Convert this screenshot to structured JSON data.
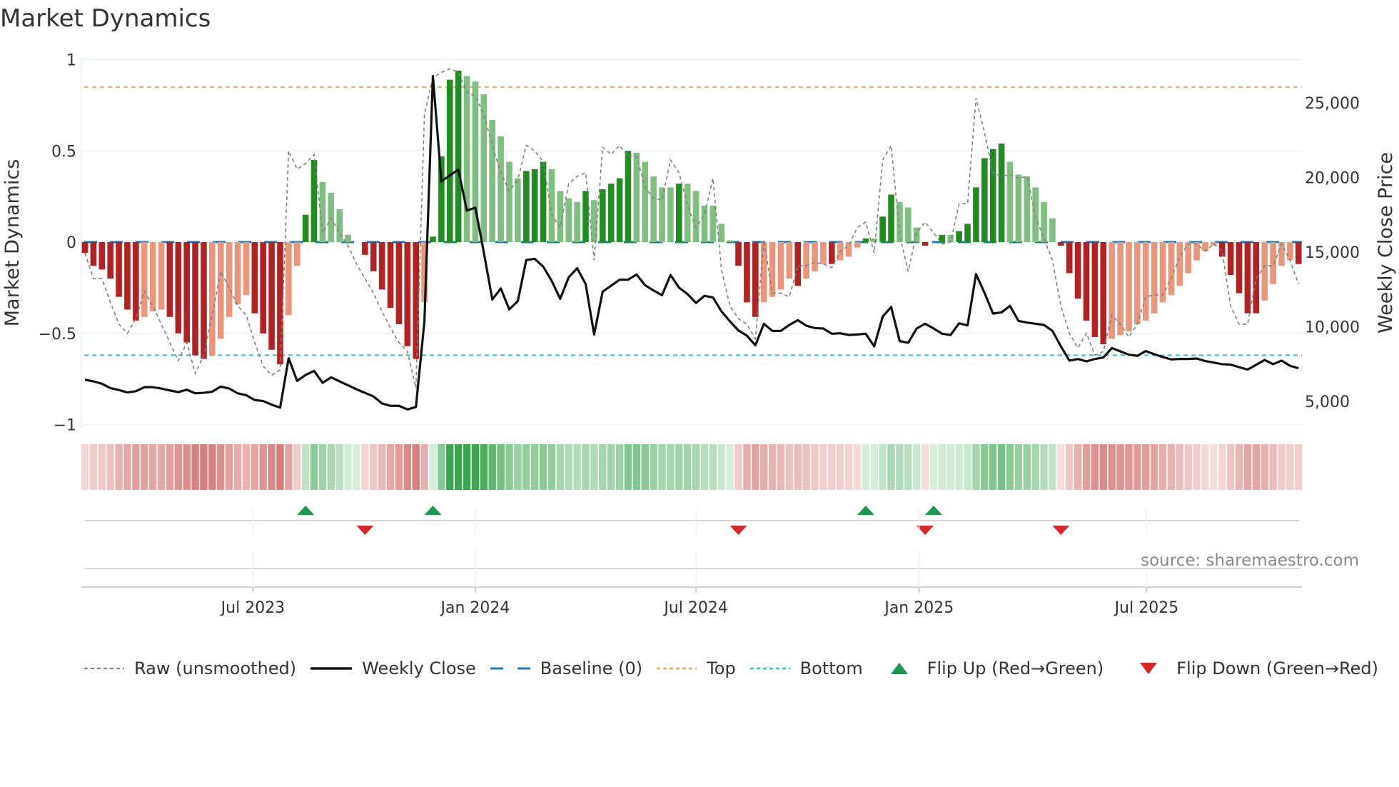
{
  "title": "Market Dynamics",
  "source": "source: sharemaestro.com",
  "legend": {
    "raw": "Raw (unsmoothed)",
    "close": "Weekly Close",
    "baseline": "Baseline (0)",
    "top": "Top",
    "bottom": "Bottom",
    "flip_up": "Flip Up (Red→Green)",
    "flip_down": "Flip Down (Green→Red)"
  },
  "colors": {
    "strong_pos": "#228b22",
    "weak_pos": "#7fbf7f",
    "strong_neg": "#b22222",
    "weak_neg": "#e9967a",
    "raw": "#808080",
    "close": "#111111",
    "baseline": "#1f77b4",
    "top": "#f0a860",
    "bottom": "#30c0d0",
    "flip_up": "#1a9850",
    "flip_down": "#d62728",
    "heat_pos": "#2ea043",
    "heat_neg": "#c8504c"
  },
  "chart_data": {
    "type": "bar",
    "frequency": "weekly",
    "y_left": {
      "label": "Market Dynamics",
      "range": [
        -1,
        1
      ],
      "ticks": [
        1,
        0.5,
        0,
        -0.5,
        -1
      ],
      "tick_labels": [
        "1",
        "0.5",
        "0",
        "−0.5",
        "−1"
      ]
    },
    "y_right": {
      "label": "Weekly Close Price",
      "ticks": [
        25000,
        20000,
        15000,
        10000,
        5000
      ],
      "tick_labels": [
        "25,000",
        "20,000",
        "15,000",
        "10,000",
        "5,000"
      ]
    },
    "x_ticks": [
      {
        "label": "Jul 2023",
        "week": 19.8
      },
      {
        "label": "Jan 2024",
        "week": 46.0
      },
      {
        "label": "Jul 2024",
        "week": 72.0
      },
      {
        "label": "Jan 2025",
        "week": 98.3
      },
      {
        "label": "Jul 2025",
        "week": 125.1
      }
    ],
    "top_level": 0.85,
    "bottom_level": -0.62,
    "baseline": 0,
    "smoothed": [
      -0.06,
      -0.13,
      -0.15,
      -0.2,
      -0.3,
      -0.37,
      -0.43,
      -0.41,
      -0.38,
      -0.37,
      -0.41,
      -0.5,
      -0.55,
      -0.62,
      -0.64,
      -0.62,
      -0.53,
      -0.41,
      -0.34,
      -0.29,
      -0.39,
      -0.5,
      -0.59,
      -0.67,
      -0.4,
      -0.13,
      0.15,
      0.45,
      0.33,
      0.27,
      0.18,
      0.04,
      0,
      -0.07,
      -0.16,
      -0.26,
      -0.36,
      -0.45,
      -0.57,
      -0.64,
      -0.33,
      0.03,
      0.47,
      0.89,
      0.94,
      0.91,
      0.88,
      0.81,
      0.67,
      0.58,
      0.44,
      0.35,
      0.39,
      0.4,
      0.44,
      0.4,
      0.28,
      0.24,
      0.22,
      0.28,
      0.23,
      0.29,
      0.32,
      0.35,
      0.5,
      0.49,
      0.44,
      0.36,
      0.3,
      0.3,
      0.32,
      0.32,
      0.28,
      0.2,
      0.2,
      0.1,
      0.01,
      -0.13,
      -0.33,
      -0.41,
      -0.33,
      -0.3,
      -0.26,
      -0.2,
      -0.24,
      -0.2,
      -0.16,
      -0.12,
      -0.12,
      -0.1,
      -0.08,
      -0.03,
      0.02,
      0.02,
      0.14,
      0.26,
      0.22,
      0.19,
      0.08,
      -0.02,
      0,
      0.04,
      0.04,
      0.06,
      0.1,
      0.3,
      0.46,
      0.51,
      0.54,
      0.44,
      0.37,
      0.36,
      0.3,
      0.22,
      0.13,
      -0.02,
      -0.17,
      -0.31,
      -0.43,
      -0.52,
      -0.56,
      -0.53,
      -0.51,
      -0.49,
      -0.45,
      -0.43,
      -0.39,
      -0.33,
      -0.29,
      -0.24,
      -0.17,
      -0.1,
      -0.05,
      -0.02,
      -0.08,
      -0.18,
      -0.28,
      -0.39,
      -0.39,
      -0.32,
      -0.23,
      -0.13,
      -0.1,
      -0.12
    ],
    "strong": [
      1,
      1,
      1,
      1,
      1,
      1,
      1,
      0,
      0,
      0,
      1,
      1,
      1,
      1,
      1,
      0,
      0,
      0,
      0,
      0,
      1,
      1,
      1,
      1,
      0,
      0,
      1,
      1,
      0,
      0,
      0,
      0,
      0,
      1,
      1,
      1,
      1,
      1,
      1,
      1,
      0,
      1,
      1,
      1,
      1,
      0,
      0,
      0,
      0,
      0,
      0,
      0,
      1,
      1,
      1,
      0,
      0,
      0,
      0,
      1,
      0,
      1,
      1,
      1,
      1,
      0,
      0,
      0,
      0,
      0,
      1,
      0,
      0,
      0,
      0,
      0,
      0,
      1,
      1,
      1,
      0,
      0,
      0,
      0,
      1,
      0,
      0,
      0,
      1,
      0,
      0,
      0,
      1,
      0,
      1,
      1,
      0,
      0,
      0,
      1,
      0,
      1,
      0,
      1,
      1,
      1,
      1,
      1,
      1,
      0,
      0,
      0,
      0,
      0,
      0,
      1,
      1,
      1,
      1,
      1,
      1,
      0,
      0,
      0,
      0,
      0,
      0,
      0,
      0,
      0,
      0,
      0,
      0,
      0,
      1,
      1,
      1,
      1,
      1,
      0,
      0,
      0,
      0,
      1
    ],
    "raw": [
      -0.06,
      -0.2,
      -0.2,
      -0.33,
      -0.45,
      -0.5,
      -0.42,
      -0.27,
      -0.35,
      -0.45,
      -0.55,
      -0.65,
      -0.55,
      -0.72,
      -0.62,
      -0.4,
      -0.16,
      -0.25,
      -0.35,
      -0.4,
      -0.55,
      -0.68,
      -0.73,
      -0.7,
      0.5,
      0.4,
      0.43,
      0.48,
      0.05,
      0.13,
      0.05,
      -0.02,
      -0.12,
      -0.2,
      -0.28,
      -0.38,
      -0.47,
      -0.55,
      -0.6,
      -0.8,
      0.7,
      0.9,
      0.93,
      0.95,
      0.93,
      0.82,
      0.8,
      0.7,
      0.53,
      0.38,
      0.28,
      0.34,
      0.53,
      0.5,
      0.44,
      0.15,
      0.08,
      0.32,
      0.36,
      0.38,
      -0.1,
      0.52,
      0.48,
      0.53,
      0.47,
      0.47,
      0.3,
      0.24,
      0.23,
      0.45,
      0.38,
      0.2,
      0.08,
      0.15,
      0.35,
      -0.15,
      -0.35,
      -0.42,
      -0.45,
      -0.53,
      0.01,
      -0.28,
      -0.28,
      -0.3,
      -0.13,
      -0.13,
      -0.11,
      -0.12,
      -0.14,
      -0.05,
      -0.02,
      0.08,
      0.11,
      -0.06,
      0.45,
      0.53,
      0.04,
      -0.16,
      0.05,
      0.11,
      0.05,
      -0.01,
      0,
      0.21,
      0.21,
      0.79,
      0.6,
      0.38,
      0.36,
      0.37,
      0.35,
      0.36,
      0.14,
      0.02,
      -0.1,
      -0.35,
      -0.5,
      -0.58,
      -0.5,
      -0.62,
      -0.6,
      -0.4,
      -0.45,
      -0.52,
      -0.45,
      -0.3,
      -0.29,
      -0.29,
      -0.2,
      -0.08,
      -0.01,
      -0.01,
      -0.05,
      -0.01,
      -0.05,
      -0.35,
      -0.45,
      -0.45,
      -0.2,
      -0.13,
      -0.13,
      -0.01,
      -0.1,
      -0.23
    ],
    "close": [
      6450,
      6340,
      6180,
      5890,
      5760,
      5600,
      5680,
      5950,
      5950,
      5860,
      5730,
      5620,
      5780,
      5540,
      5570,
      5650,
      5990,
      5860,
      5540,
      5410,
      5090,
      5020,
      4780,
      4580,
      7890,
      6370,
      6770,
      7040,
      6240,
      6610,
      6340,
      6080,
      5810,
      5570,
      5330,
      4860,
      4700,
      4700,
      4460,
      4620,
      10360,
      26790,
      19740,
      20140,
      20530,
      17780,
      17980,
      14980,
      11830,
      12560,
      11160,
      11710,
      14470,
      14550,
      14030,
      13070,
      11870,
      13310,
      13920,
      12860,
      9480,
      12350,
      12750,
      13150,
      13150,
      13500,
      12780,
      12430,
      12110,
      13470,
      12620,
      12190,
      11590,
      12070,
      11960,
      11030,
      10360,
      9750,
      9400,
      8760,
      10200,
      9720,
      9720,
      10120,
      10440,
      10070,
      9910,
      9880,
      9530,
      9560,
      9450,
      9480,
      9530,
      8680,
      10680,
      11320,
      9040,
      8920,
      9880,
      10200,
      9880,
      9530,
      9450,
      10230,
      10090,
      13520,
      12270,
      10880,
      10960,
      11400,
      10390,
      10280,
      10200,
      10120,
      9720,
      8680,
      7730,
      7840,
      7680,
      7840,
      7940,
      8570,
      8350,
      8130,
      8050,
      8370,
      8160,
      7970,
      7810,
      7840,
      7840,
      7870,
      7700,
      7600,
      7490,
      7460,
      7290,
      7130,
      7450,
      7770,
      7490,
      7730,
      7380,
      7220
    ],
    "flips_up": [
      26,
      41,
      92,
      100
    ],
    "flips_down": [
      33,
      77,
      99,
      115
    ]
  }
}
